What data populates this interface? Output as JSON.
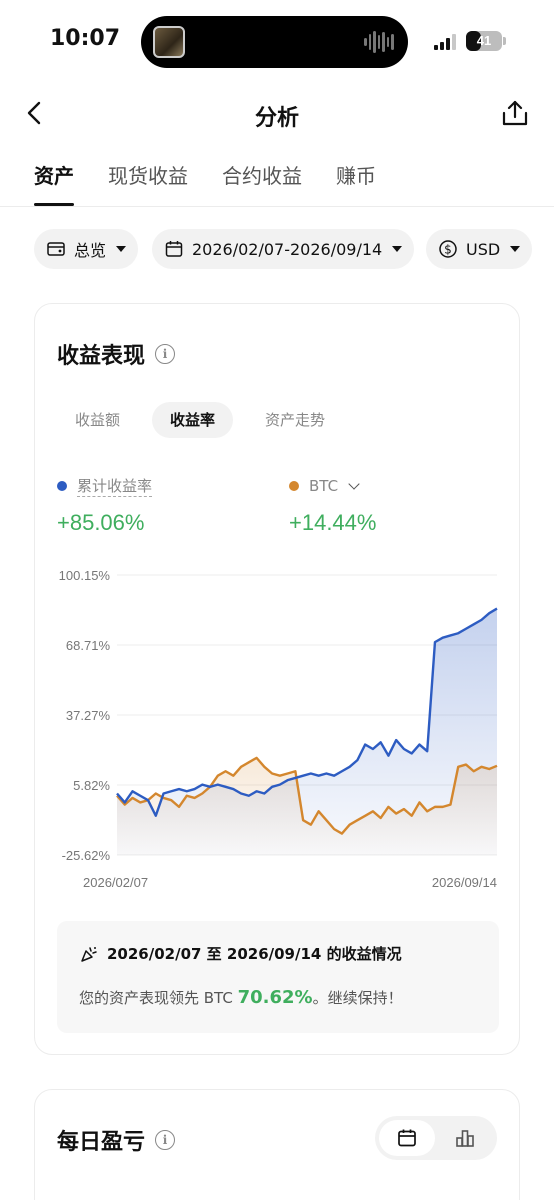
{
  "status": {
    "time": "10:07",
    "battery": "41",
    "battery_level": 0.41
  },
  "nav": {
    "title": "分析"
  },
  "tabs": [
    {
      "label": "资产",
      "active": true
    },
    {
      "label": "现货收益",
      "active": false
    },
    {
      "label": "合约收益",
      "active": false
    },
    {
      "label": "赚币",
      "active": false
    }
  ],
  "filters": {
    "overview": "总览",
    "date_range": "2026/02/07-2026/09/14",
    "currency": "USD"
  },
  "performance": {
    "title": "收益表现",
    "subtabs": [
      {
        "label": "收益额",
        "active": false
      },
      {
        "label": "收益率",
        "active": true
      },
      {
        "label": "资产走势",
        "active": false
      }
    ],
    "legend": {
      "primary_label": "累计收益率",
      "primary_value": "+85.06%",
      "compare_label": "BTC",
      "compare_value": "+14.44%"
    },
    "summary_title": "2026/02/07 至 2026/09/14 的收益情况",
    "summary_prefix": "您的资产表现领先 BTC ",
    "summary_highlight": "70.62%",
    "summary_suffix": "。继续保持！"
  },
  "daily": {
    "title": "每日盈亏"
  },
  "colors": {
    "accent_blue": "#2d5cc2",
    "btc_orange": "#d4872e",
    "positive_green": "#3fae5e"
  },
  "chart_data": {
    "type": "line",
    "x_start": "2026/02/07",
    "x_end": "2026/09/14",
    "y_ticks": [
      "100.15%",
      "68.71%",
      "37.27%",
      "5.82%",
      "-25.62%"
    ],
    "ylim": [
      -25.62,
      100.15
    ],
    "grid": true,
    "series": [
      {
        "name": "累计收益率",
        "color": "#2d5cc2",
        "values": [
          2,
          -2,
          3,
          1,
          -1,
          -8,
          2,
          3,
          4,
          3,
          4,
          6,
          5,
          6,
          5,
          4,
          2,
          1,
          3,
          2,
          5,
          6,
          8,
          9,
          10,
          11,
          10,
          11,
          10,
          12,
          14,
          17,
          24,
          22,
          25,
          19,
          26,
          22,
          20,
          24,
          21,
          70,
          72,
          73,
          74,
          76,
          78,
          80,
          83,
          85.06
        ]
      },
      {
        "name": "BTC",
        "color": "#d4872e",
        "values": [
          1,
          -3,
          0,
          -2,
          -1,
          2,
          0,
          -1,
          -4,
          1,
          0,
          2,
          5,
          10,
          12,
          10,
          14,
          16,
          18,
          14,
          11,
          10,
          11,
          12,
          -10,
          -12,
          -6,
          -10,
          -14,
          -16,
          -12,
          -10,
          -8,
          -6,
          -9,
          -4,
          -7,
          -5,
          -8,
          -2,
          -6,
          -4,
          -4,
          -3,
          14,
          15,
          12,
          14,
          13,
          14.44
        ]
      }
    ]
  }
}
